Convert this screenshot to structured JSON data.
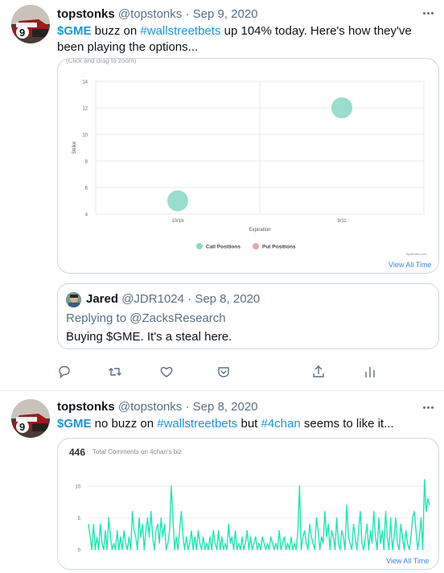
{
  "tweets": [
    {
      "name": "topstonks",
      "handle": "@topstonks",
      "sep": "·",
      "date": "Sep 9, 2020",
      "text_parts": [
        "$GME",
        " buzz on ",
        "#wallstreetbets",
        " up 104% today. Here's how they've been playing the options..."
      ],
      "card": {
        "hint": "(Click and drag to zoom)",
        "view_all": "View All Time",
        "brand": "Topstonks.com"
      },
      "quote": {
        "name": "Jared",
        "handle": "@JDR1024",
        "sep": "·",
        "date": "Sep 8, 2020",
        "replying_prefix": "Replying to ",
        "replying_to": "@ZacksResearch",
        "text": "Buying $GME. It's a steal here."
      }
    },
    {
      "name": "topstonks",
      "handle": "@topstonks",
      "sep": "·",
      "date": "Sep 8, 2020",
      "text_parts": [
        "$GME",
        " no buzz on ",
        "#wallstreetbets",
        " but ",
        "#4chan",
        " seems to like it..."
      ],
      "card": {
        "count": "446",
        "count_label": "Total Comments on 4chan's biz",
        "view_all": "View All Time"
      }
    }
  ],
  "actions": [
    {
      "icon": "reply-icon"
    },
    {
      "icon": "retweet-icon"
    },
    {
      "icon": "like-icon"
    },
    {
      "icon": "topics-icon"
    },
    {
      "icon": "share-icon"
    },
    {
      "icon": "analytics-icon"
    }
  ],
  "colors": {
    "link": "#1b95e0",
    "call": "#8fd8c8",
    "put": "#f4a3a3",
    "line": "#1ee6b4"
  },
  "chart_data": [
    {
      "type": "scatter",
      "xlabel": "Expiration",
      "ylabel": "Strike",
      "categories": [
        "10/16",
        "9/11"
      ],
      "yticks": [
        4,
        6,
        8,
        10,
        12,
        14
      ],
      "ylim": [
        4,
        14
      ],
      "grid": true,
      "legend_position": "bottom",
      "series": [
        {
          "name": "Call Positions",
          "color": "#8fd8c8",
          "points": [
            {
              "x": "10/16",
              "y": 5
            },
            {
              "x": "9/11",
              "y": 12
            }
          ]
        },
        {
          "name": "Put Positions",
          "color": "#f4a3a3",
          "points": []
        }
      ]
    },
    {
      "type": "line",
      "title": "Total Comments on 4chan's biz",
      "total": 446,
      "yticks": [
        0,
        5,
        10
      ],
      "ylim": [
        0,
        12
      ],
      "grid": true,
      "series": [
        {
          "name": "",
          "color": "#1ee6b4",
          "values": [
            4,
            2,
            0,
            4,
            0,
            2,
            0,
            4,
            1,
            0,
            3,
            0,
            5,
            2,
            0,
            1,
            0,
            3,
            0,
            2,
            0,
            3,
            1,
            0,
            2,
            0,
            6,
            3,
            2,
            0,
            5,
            2,
            4,
            0,
            3,
            5,
            2,
            6,
            2,
            0,
            3,
            4,
            1,
            5,
            2,
            4,
            0,
            1,
            3,
            10,
            5,
            0,
            2,
            0,
            3,
            6,
            2,
            0,
            2,
            0,
            1,
            3,
            0,
            2,
            0,
            3,
            1,
            0,
            2,
            0,
            1,
            0,
            2,
            0,
            3,
            1,
            0,
            3,
            0,
            2,
            0,
            1,
            0,
            4,
            1,
            2,
            0,
            3,
            0,
            1,
            0,
            2,
            0,
            1,
            3,
            0,
            2,
            0,
            1,
            2,
            0,
            1,
            0,
            2,
            1,
            0,
            1,
            0,
            2,
            1,
            0,
            1,
            0,
            3,
            0,
            1,
            2,
            0,
            1,
            0,
            2,
            0,
            1,
            0,
            3,
            10,
            0,
            2,
            3,
            1,
            0,
            4,
            2,
            1,
            0,
            5,
            3,
            0,
            2,
            1,
            6,
            2,
            4,
            0,
            3,
            2,
            0,
            5,
            1,
            0,
            3,
            2,
            0,
            7,
            2,
            1,
            0,
            4,
            2,
            0,
            3,
            6,
            1,
            0,
            2,
            4,
            0,
            3,
            1,
            6,
            2,
            0,
            5,
            1,
            3,
            0,
            6,
            2,
            0,
            5,
            0,
            2,
            5,
            1,
            0,
            4,
            2,
            0,
            3,
            1,
            0,
            2,
            5,
            6,
            3,
            0,
            2,
            5,
            0,
            11,
            6,
            8,
            7
          ]
        }
      ]
    }
  ]
}
